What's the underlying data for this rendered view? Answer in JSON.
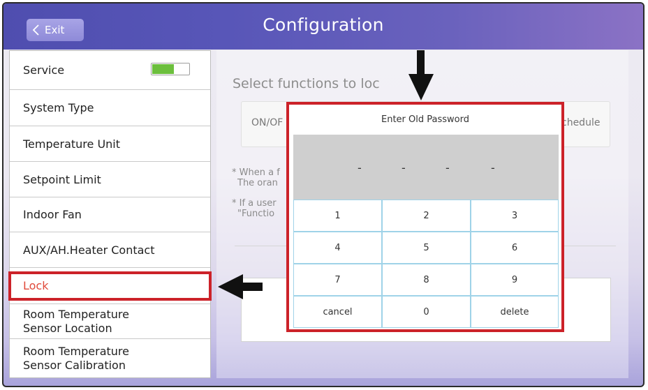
{
  "header": {
    "exit_label": "Exit",
    "title": "Configuration"
  },
  "sidebar": {
    "items": [
      {
        "label": "Service"
      },
      {
        "label": "System Type"
      },
      {
        "label": "Temperature Unit"
      },
      {
        "label": "Setpoint Limit"
      },
      {
        "label": "Indoor Fan"
      },
      {
        "label": "AUX/AH.Heater Contact"
      },
      {
        "label": "Lock"
      },
      {
        "label_line1": "Room Temperature",
        "label_line2": "Sensor Location"
      },
      {
        "label_line1": "Room Temperature",
        "label_line2": "Sensor Calibration"
      }
    ],
    "service_toggle": "on"
  },
  "content": {
    "select_title": "Select functions to loc",
    "func_onoff": "ON/OF",
    "func_schedule": "chedule",
    "note1_line1": "* When a f",
    "note1_line2": "The oran",
    "note2_line1": "* If a user",
    "note2_line2": "\"Functio"
  },
  "dialog": {
    "title": "Enter Old Password",
    "password_placeholders": [
      "-",
      "-",
      "-",
      "-"
    ],
    "keys": [
      "1",
      "2",
      "3",
      "4",
      "5",
      "6",
      "7",
      "8",
      "9",
      "cancel",
      "0",
      "delete"
    ]
  },
  "colors": {
    "title_bar": "#5856b8",
    "highlight": "#cc2229",
    "lock_text": "#e0493a",
    "toggle_on": "#6cbf3d",
    "keypad_border": "#9fd3e8"
  }
}
